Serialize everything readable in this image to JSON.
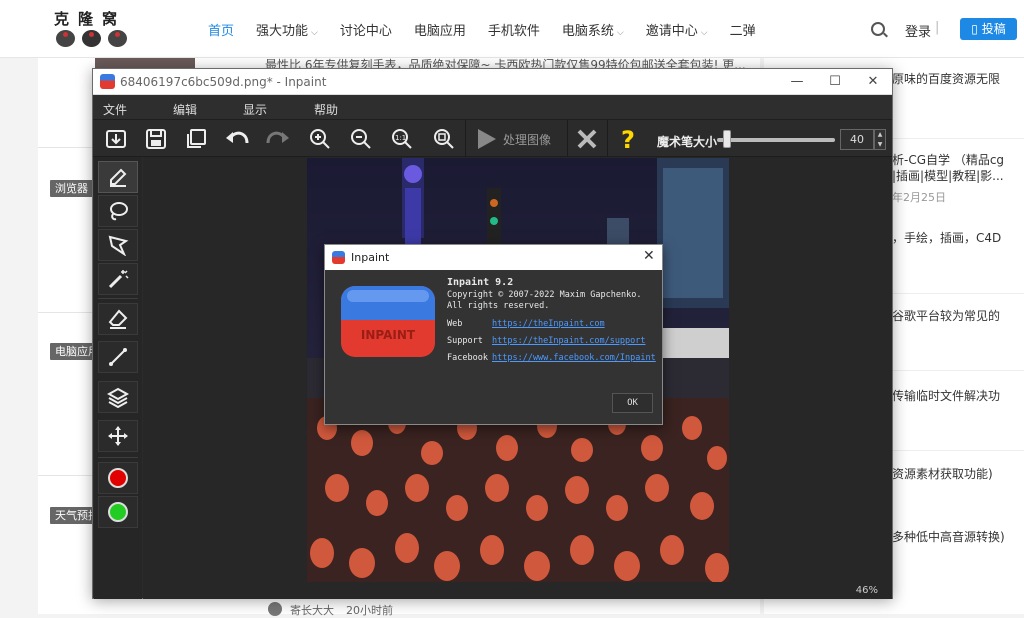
{
  "site": {
    "logo_text": "克隆窝",
    "nav": [
      {
        "label": "首页",
        "active": true,
        "caret": false
      },
      {
        "label": "强大功能",
        "caret": true
      },
      {
        "label": "讨论中心",
        "caret": false
      },
      {
        "label": "电脑应用",
        "caret": false
      },
      {
        "label": "手机软件",
        "caret": false
      },
      {
        "label": "电脑系统",
        "caret": true
      },
      {
        "label": "邀请中心",
        "caret": true
      },
      {
        "label": "二弹",
        "caret": false
      }
    ],
    "login": "登录",
    "post_button": "投稿",
    "feed_headline": "最性比 6年专供复刻手表，品质绝对保障~ 卡西欧热门款仅售99特价包邮送全套包装! 更...",
    "side_tags": [
      "浏览器",
      "电脑应用",
      "天气预报"
    ],
    "right_items": [
      {
        "text": "原味的百度资源无限",
        "meta": false
      },
      {
        "text": "析-CG自学 （精品cg",
        "meta": false
      },
      {
        "text": "|插画|模型|教程|影...",
        "meta": false
      },
      {
        "text": "年2月25日",
        "meta": true
      },
      {
        "text": "，手绘，插画，C4D",
        "meta": false
      },
      {
        "text": "谷歌平台较为常见的",
        "meta": false
      },
      {
        "text": "传输临时文件解决功",
        "meta": false
      },
      {
        "text": "资源素材获取功能)",
        "meta": false
      },
      {
        "text": "多种低中高音源转换)",
        "meta": false
      }
    ],
    "bottom_author": "寄长大大",
    "bottom_time": "20小时前"
  },
  "window": {
    "title": "68406197c6bc509d.png* - Inpaint",
    "controls": [
      "—",
      "☐",
      "✕"
    ],
    "menu": [
      "文件",
      "编辑",
      "显示",
      "帮助"
    ],
    "toolbar": {
      "process_label": "处理图像",
      "brush_label": "魔术笔大小",
      "brush_size": "40",
      "brush_size_fraction": 0.05
    },
    "zoom": "46%"
  },
  "tools": {
    "primary_color": "#e00000",
    "secondary_color": "#22cc22"
  },
  "about": {
    "title": "Inpaint",
    "logo_word": "INPAINT",
    "version": "Inpaint 9.2",
    "copyright": "Copyright © 2007-2022 Maxim Gapchenko.",
    "rights": "All rights reserved.",
    "web_label": "Web",
    "web_url": "https://theInpaint.com",
    "support_label": "Support",
    "support_url": "https://theInpaint.com/support",
    "facebook_label": "Facebook",
    "facebook_url": "https://www.facebook.com/Inpaint",
    "ok": "OK"
  }
}
